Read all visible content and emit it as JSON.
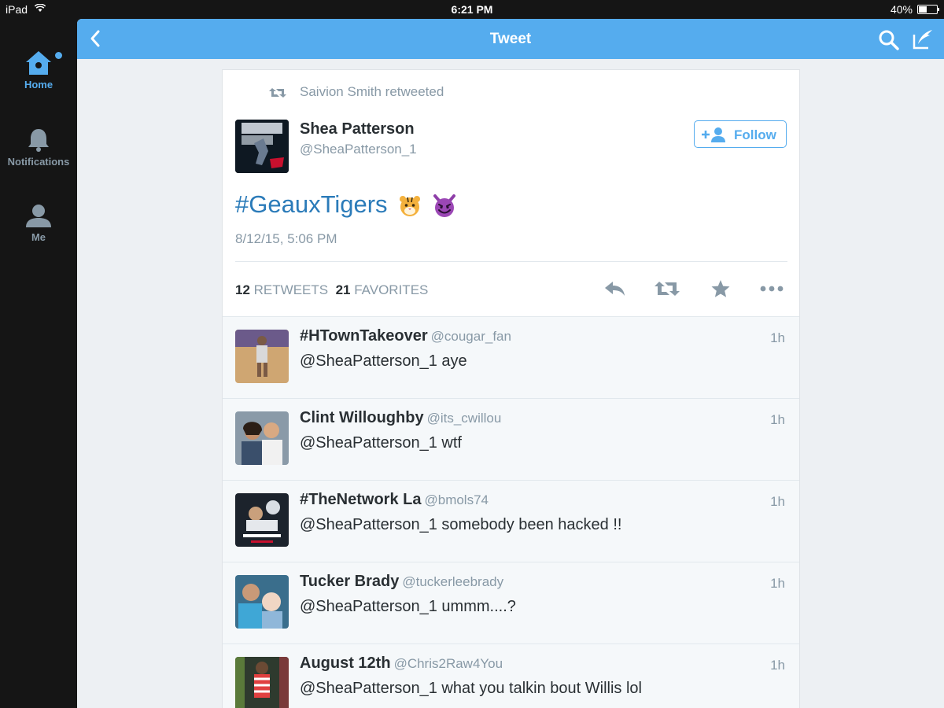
{
  "status_bar": {
    "carrier": "iPad",
    "time": "6:21 PM",
    "battery": "40%",
    "battery_level": 0.4
  },
  "sidebar": {
    "items": [
      {
        "label": "Home",
        "icon": "home-icon",
        "active": true
      },
      {
        "label": "Notifications",
        "icon": "bell-icon",
        "active": false
      },
      {
        "label": "Me",
        "icon": "person-icon",
        "active": false
      }
    ]
  },
  "nav": {
    "title": "Tweet",
    "back_icon": "chevron-left-icon",
    "search_icon": "search-icon",
    "compose_icon": "compose-icon"
  },
  "tweet": {
    "retweeted_by": "Saivion Smith retweeted",
    "author_name": "Shea Patterson",
    "author_handle": "@SheaPatterson_1",
    "follow_label": "Follow",
    "hashtag": "#GeauxTigers",
    "emojis": [
      "tiger-face-emoji",
      "smiling-imp-emoji"
    ],
    "date": "8/12/15, 5:06 PM",
    "retweets_count": "12",
    "retweets_label": "RETWEETS",
    "favorites_count": "21",
    "favorites_label": "FAVORITES"
  },
  "replies": [
    {
      "name": "#HTownTakeover",
      "handle": "@cougar_fan",
      "time": "1h",
      "text": "@SheaPatterson_1 aye"
    },
    {
      "name": "Clint Willoughby",
      "handle": "@its_cwillou",
      "time": "1h",
      "text": "@SheaPatterson_1 wtf"
    },
    {
      "name": "#TheNetwork La",
      "handle": "@bmols74",
      "time": "1h",
      "text": "@SheaPatterson_1 somebody been hacked !!"
    },
    {
      "name": "Tucker Brady",
      "handle": "@tuckerleebrady",
      "time": "1h",
      "text": "@SheaPatterson_1 ummm....?"
    },
    {
      "name": "August 12th",
      "handle": "@Chris2Raw4You",
      "time": "1h",
      "text": "@SheaPatterson_1 what you talkin bout Willis lol"
    }
  ],
  "colors": {
    "accent": "#55acee",
    "hashtag": "#2b7bb9",
    "muted": "#8899a6",
    "text": "#292f33"
  }
}
